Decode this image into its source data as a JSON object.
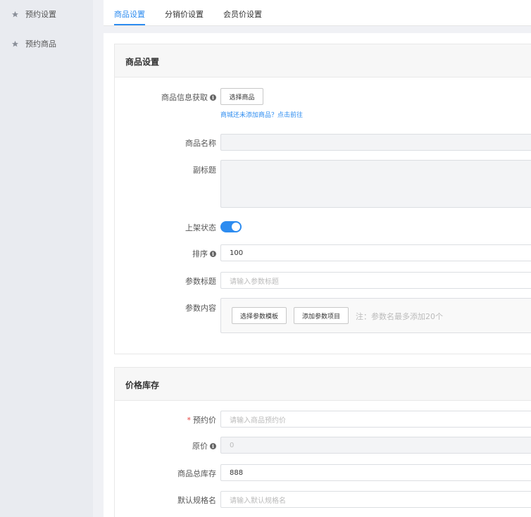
{
  "sidebar": {
    "items": [
      {
        "label": "预约设置",
        "icon": "star-icon"
      },
      {
        "label": "预约商品",
        "icon": "star-icon"
      }
    ]
  },
  "tabs": [
    {
      "label": "商品设置",
      "active": true
    },
    {
      "label": "分销价设置",
      "active": false
    },
    {
      "label": "会员价设置",
      "active": false
    }
  ],
  "product_section": {
    "title": "商品设置",
    "product_info_label": "商品信息获取",
    "select_product_button": "选择商品",
    "add_product_link": "商城还未添加商品？点击前往",
    "name_label": "商品名称",
    "name_value": "",
    "subtitle_label": "副标题",
    "subtitle_value": "",
    "listing_label": "上架状态",
    "listing_on": true,
    "sort_label": "排序",
    "sort_value": "100",
    "param_title_label": "参数标题",
    "param_title_placeholder": "请输入参数标题",
    "param_content_label": "参数内容",
    "select_template_button": "选择参数模板",
    "add_param_button": "添加参数项目",
    "param_note": "注：参数名最多添加20个"
  },
  "price_section": {
    "title": "价格库存",
    "required_mark": "*",
    "reserve_price_label": "预约价",
    "reserve_price_placeholder": "请输入商品预约价",
    "original_price_label": "原价",
    "original_price_value": "0",
    "stock_label": "商品总库存",
    "stock_value": "888",
    "spec_name_label": "默认规格名",
    "spec_name_placeholder": "请输入默认规格名"
  },
  "colors": {
    "accent": "#2d8cf0",
    "required": "#e64340",
    "sidebar_bg": "#e9ebf0",
    "page_bg": "#f0f1f5"
  }
}
